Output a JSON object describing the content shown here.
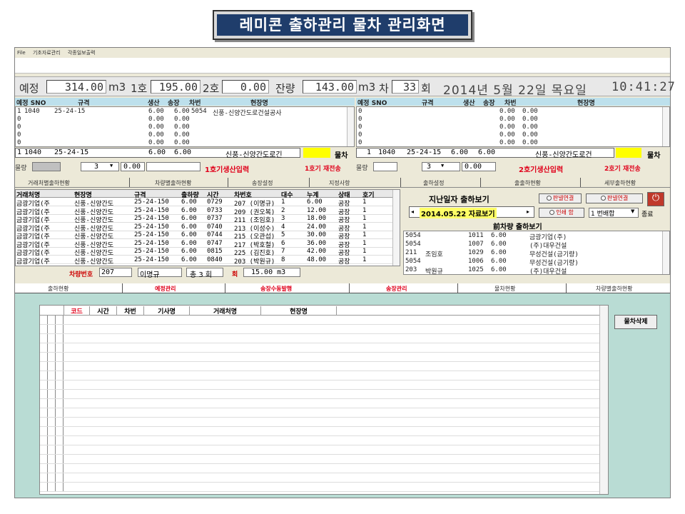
{
  "page_title": "레미콘 출하관리 물차 관리화면",
  "menu": [
    "File",
    "기초자료관리",
    "각종일보출력"
  ],
  "status": {
    "yejeong_label": "예정",
    "yejeong_val": "314.00",
    "unit_m3": "m3",
    "h1_label": "1호",
    "h1_val": "195.00",
    "h2_label": "2호",
    "h2_val": "0.00",
    "remain_label": "잔량",
    "remain_val": "143.00",
    "cha_label": "차",
    "cha_val": "33",
    "hoe": "회",
    "date": "2014년  5월 22일 목요일",
    "time": "10:41:27"
  },
  "left_panel": {
    "headers": [
      "예정 SNO",
      "규격",
      "생산",
      "송장",
      "차번",
      "현장명"
    ],
    "rows": [
      [
        "1",
        "1040",
        "25-24-15",
        "6.00",
        "6.00",
        "5054",
        "신풍-신양간도로건설공사"
      ],
      [
        "0",
        "",
        "",
        "0.00",
        "0.00",
        "",
        ""
      ],
      [
        "0",
        "",
        "",
        "0.00",
        "0.00",
        "",
        ""
      ],
      [
        "0",
        "",
        "",
        "0.00",
        "0.00",
        "",
        ""
      ],
      [
        "0",
        "",
        "",
        "0.00",
        "0.00",
        "",
        ""
      ]
    ],
    "sel": {
      "n": "1",
      "sno": "1040",
      "spec": "25-24-15",
      "a": "6.00",
      "b": "6.00",
      "site": "신풍-신양간도로긴"
    },
    "mulcha": "물차",
    "baljae": "물량",
    "qty": "3",
    "val": "0.00",
    "input_btn": "1호기생산입력",
    "resend_btn": "1호기 재전송"
  },
  "right_panel": {
    "headers": [
      "예정 SNO",
      "규격",
      "생산",
      "송장",
      "차번",
      "현장명"
    ],
    "rows": [
      [
        "0",
        "0.00",
        "0.00"
      ],
      [
        "0",
        "0.00",
        "0.00"
      ],
      [
        "0",
        "0.00",
        "0.00"
      ],
      [
        "0",
        "0.00",
        "0.00"
      ],
      [
        "0",
        "0.00",
        "0.00"
      ]
    ],
    "sel": {
      "n": "1",
      "sno": "1040",
      "spec": "25-24-15",
      "a": "6.00",
      "b": "6.00",
      "site": "신풍-신양간도로건"
    },
    "mulcha": "물차",
    "baljae": "물량",
    "qty": "3",
    "val": "0.00",
    "input_btn": "2호기생산입력",
    "resend_btn": "2호기 재전송"
  },
  "tabs_mid": [
    "거래처별출하현황",
    "차량별출하현황",
    "송장설정",
    "지정사항",
    "출하설정",
    "출출하현황",
    "세부출하현황"
  ],
  "ship_table": {
    "headers": [
      "거래처명",
      "현장명",
      "규격",
      "출하량",
      "시간",
      "차번호",
      "대수",
      "누계",
      "상태",
      "호기"
    ],
    "rows": [
      [
        "금광기업(주",
        "신풍-신양간도",
        "25-24-150",
        "6.00",
        "0729",
        "207 (이명규)",
        "1",
        "6.00",
        "공장",
        "1"
      ],
      [
        "금광기업(주",
        "신풍-신양간도",
        "25-24-150",
        "6.00",
        "0733",
        "209 (권오복)",
        "2",
        "12.00",
        "공장",
        "1"
      ],
      [
        "금광기업(주",
        "신풍-신양간도",
        "25-24-150",
        "6.00",
        "0737",
        "211 (조임호)",
        "3",
        "18.00",
        "공장",
        "1"
      ],
      [
        "금광기업(주",
        "신풍-신양간도",
        "25-24-150",
        "6.00",
        "0740",
        "213 (이성수)",
        "4",
        "24.00",
        "공장",
        "1"
      ],
      [
        "금광기업(주",
        "신풍-신양간도",
        "25-24-150",
        "6.00",
        "0744",
        "215 (오관섭)",
        "5",
        "30.00",
        "공장",
        "1"
      ],
      [
        "금광기업(주",
        "신풍-신양간도",
        "25-24-150",
        "6.00",
        "0747",
        "217 (박호철)",
        "6",
        "36.00",
        "공장",
        "1"
      ],
      [
        "금광기업(주",
        "신풍-신양간도",
        "25-24-150",
        "6.00",
        "0815",
        "225 (김진호)",
        "7",
        "42.00",
        "공장",
        "1"
      ],
      [
        "금광기업(주",
        "신풍-신양간도",
        "25-24-150",
        "6.00",
        "0840",
        "203 (박원규)",
        "8",
        "48.00",
        "공장",
        "1"
      ]
    ],
    "footer": {
      "vehicle_label": "차량번호",
      "vehicle": "207",
      "driver": "이명규",
      "total_label": "총 3 회",
      "hoe": "회",
      "total": "15.00 m3"
    }
  },
  "history": {
    "title": "지난일자 출하보기",
    "date_btn": "2014.05.22 자료보기",
    "radio1": "판넬연결",
    "radio2": "판넬연결",
    "radio3": "인쇄 함",
    "combo": "1 번배합",
    "close": "종료",
    "prev_title": "前차량 출하보기",
    "rows": [
      [
        "5054",
        "",
        "1011",
        "6.00",
        "금광기업(주)"
      ],
      [
        "5054",
        "",
        "1007",
        "6.00",
        "(주)대우건설"
      ],
      [
        "211",
        "조임호",
        "1029",
        "6.00",
        "무성건설(금기량)"
      ],
      [
        "5054",
        "",
        "1006",
        "6.00",
        "무성건설(금기량)"
      ],
      [
        "203",
        "박원규",
        "1025",
        "6.00",
        "(주)대우건설"
      ]
    ]
  },
  "tabs_bottom": [
    "출하현황",
    "예정관리",
    "송장수동발행",
    "송장관리",
    "물차현황",
    "차량별출하현황"
  ],
  "grid": {
    "headers": [
      "코드",
      "시간",
      "차번",
      "기사명",
      "거래처명",
      "현장명"
    ],
    "delete_btn": "물차삭제"
  }
}
